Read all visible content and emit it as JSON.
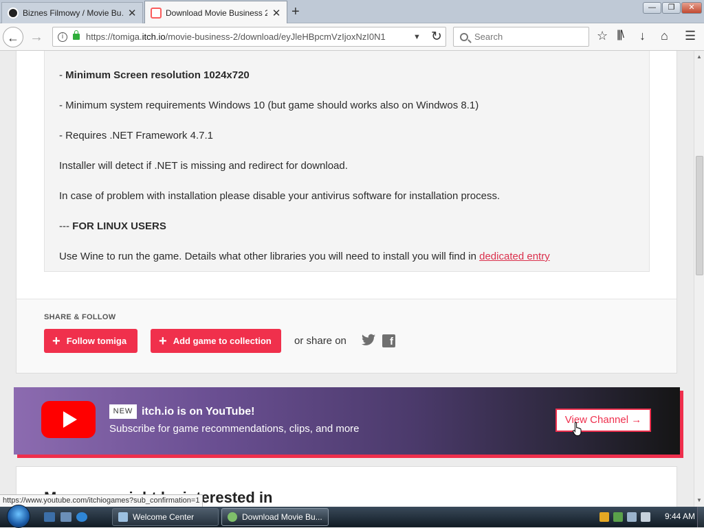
{
  "browser": {
    "tabs": [
      {
        "title": "Biznes Filmowy / Movie Bu…",
        "close": "✕"
      },
      {
        "title": "Download Movie Business 2",
        "close": "✕"
      }
    ],
    "new_tab": "+",
    "url_host": "https://tomiga.",
    "url_domain": "itch.io",
    "url_path": "/movie-business-2/download/eyJleHBpcmVzIjoxNzI0N1",
    "search_placeholder": "Search",
    "window_buttons": {
      "minimize": "—",
      "maximize": "❐",
      "close": "✕"
    }
  },
  "description": {
    "lines": [
      {
        "prefix": "- ",
        "bold": "Minimum Screen resolution 1024x720"
      },
      {
        "text": "- Minimum system requirements Windows 10 (but game should works also on Windwos 8.1)"
      },
      {
        "text": "- Requires .NET Framework 4.7.1"
      },
      {
        "text": "Installer will detect if .NET is missing and redirect for download."
      },
      {
        "text": "In case of problem with installation please disable your antivirus software for installation process."
      },
      {
        "prefix": "--- ",
        "bold": "FOR LINUX USERS"
      },
      {
        "text": "Use Wine to run the game. Details what other libraries you will need to install you will find in ",
        "link": "dedicated entry"
      }
    ]
  },
  "share": {
    "heading": "SHARE & FOLLOW",
    "follow_label": "Follow tomiga",
    "collection_label": "Add game to collection",
    "or_share": "or share on"
  },
  "banner": {
    "badge": "NEW",
    "headline": "itch.io is on YouTube!",
    "subtitle": "Subscribe for game recommendations, clips, and more",
    "button": "View Channel →"
  },
  "next_section": {
    "title": "More you might be interested in"
  },
  "status_url": "https://www.youtube.com/itchiogames?sub_confirmation=1",
  "taskbar": {
    "items": [
      {
        "label": "Welcome Center"
      },
      {
        "label": "Download Movie Bu..."
      }
    ],
    "clock": "9:44 AM"
  },
  "colors": {
    "accent": "#f0304c",
    "link": "#da2f4b"
  }
}
